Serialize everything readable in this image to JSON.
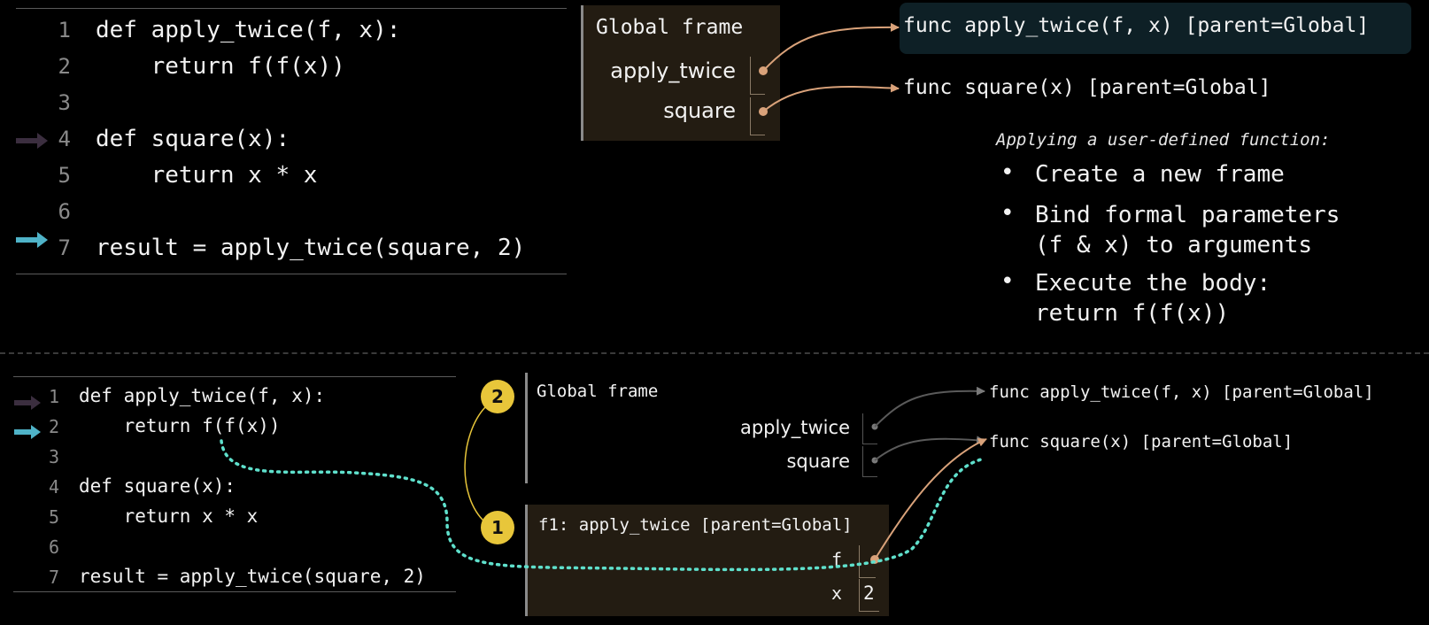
{
  "top_panel": {
    "code": [
      {
        "num": "1",
        "text": "def apply_twice(f, x):"
      },
      {
        "num": "2",
        "text": "    return f(f(x))"
      },
      {
        "num": "3",
        "text": ""
      },
      {
        "num": "4",
        "text": "def square(x):"
      },
      {
        "num": "5",
        "text": "    return x * x"
      },
      {
        "num": "6",
        "text": ""
      },
      {
        "num": "7",
        "text": "result = apply_twice(square, 2)"
      }
    ],
    "prev_line_arrow_line": "4",
    "next_line_arrow_line": "7",
    "global_frame": {
      "title": "Global frame",
      "vars": [
        "apply_twice",
        "square"
      ]
    },
    "func_objects": [
      "func apply_twice(f, x) [parent=Global]",
      "func square(x) [parent=Global]"
    ],
    "note": {
      "title": "Applying a user-defined function:",
      "bullets": [
        {
          "line1": "Create a new frame",
          "line2": ""
        },
        {
          "line1": "Bind formal parameters",
          "line2": "(f & x) to arguments"
        },
        {
          "line1": "Execute the body:",
          "line2": "return f(f(x))"
        }
      ]
    }
  },
  "bottom_panel": {
    "code": [
      {
        "num": "1",
        "text": "def apply_twice(f, x):"
      },
      {
        "num": "2",
        "text": "    return f(f(x))"
      },
      {
        "num": "3",
        "text": ""
      },
      {
        "num": "4",
        "text": "def square(x):"
      },
      {
        "num": "5",
        "text": "    return x * x"
      },
      {
        "num": "6",
        "text": ""
      },
      {
        "num": "7",
        "text": "result = apply_twice(square, 2)"
      }
    ],
    "prev_line_arrow_line": "1",
    "next_line_arrow_line": "2",
    "global_frame": {
      "title": "Global frame",
      "vars": [
        "apply_twice",
        "square"
      ]
    },
    "f1_frame": {
      "title": "f1: apply_twice [parent=Global]",
      "vars": [
        {
          "name": "f",
          "value": ""
        },
        {
          "name": "x",
          "value": "2"
        }
      ]
    },
    "func_objects": [
      "func apply_twice(f, x) [parent=Global]",
      "func square(x) [parent=Global]"
    ],
    "steps": [
      "2",
      "1"
    ]
  },
  "colors": {
    "background": "#000000",
    "frame_bg": "#231c12",
    "pointer_arrow": "#d9a27a",
    "prev_line_arrow": "#3b2e3f",
    "next_line_arrow": "#4fb3c8",
    "step_circle": "#e8c63a",
    "dotted_path": "#5fe0cc",
    "highlight_box": "#0e2026"
  },
  "icons": [
    "prev-line-arrow-icon",
    "next-line-arrow-icon"
  ]
}
